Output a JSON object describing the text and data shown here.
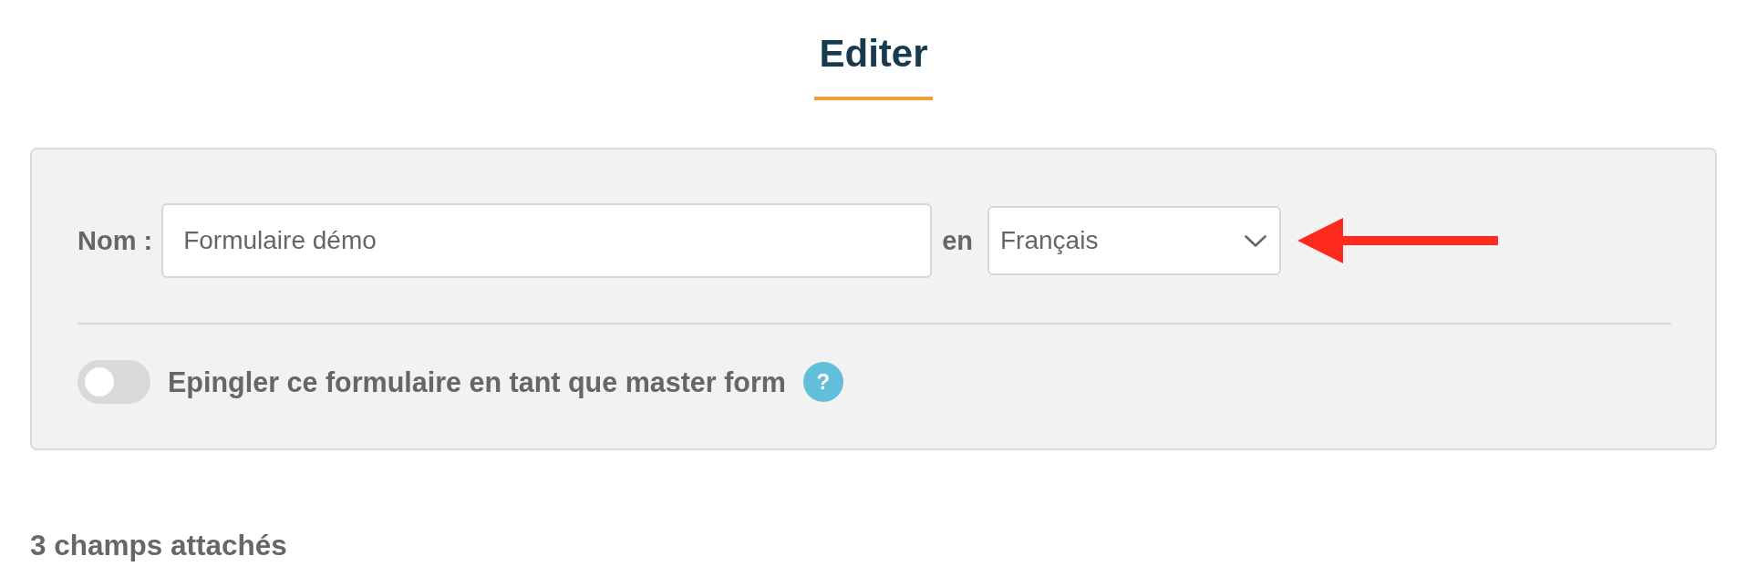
{
  "header": {
    "title": "Editer"
  },
  "form": {
    "name_label": "Nom :",
    "name_input": {
      "value": "Formulaire démo"
    },
    "language_label": "en",
    "language_select": {
      "value": "Français"
    },
    "pin_toggle": {
      "on": false,
      "label": "Epingler ce formulaire en tant que master form"
    },
    "help": "?"
  },
  "fields_count": "3 champs attachés"
}
